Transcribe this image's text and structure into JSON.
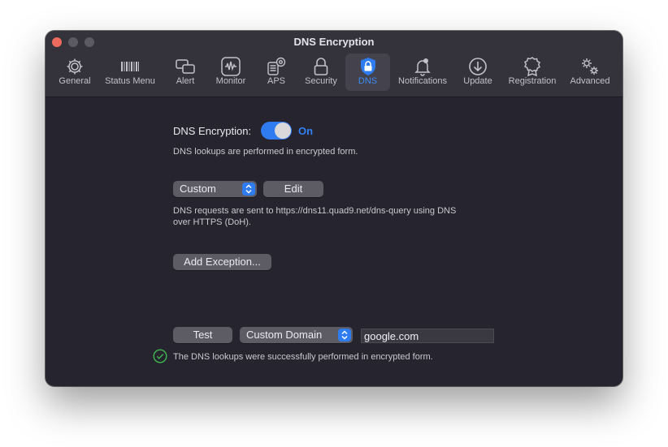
{
  "window": {
    "title": "DNS Encryption"
  },
  "toolbar": {
    "tabs": [
      {
        "id": "general",
        "label": "General",
        "icon": "gear-icon"
      },
      {
        "id": "status-menu",
        "label": "Status Menu",
        "icon": "menubar-icon"
      },
      {
        "id": "alert",
        "label": "Alert",
        "icon": "alert-windows-icon"
      },
      {
        "id": "monitor",
        "label": "Monitor",
        "icon": "monitor-icon"
      },
      {
        "id": "aps",
        "label": "APS",
        "icon": "aps-icon"
      },
      {
        "id": "security",
        "label": "Security",
        "icon": "lock-icon"
      },
      {
        "id": "dns",
        "label": "DNS",
        "icon": "shield-lock-icon"
      },
      {
        "id": "notifications",
        "label": "Notifications",
        "icon": "bell-icon"
      },
      {
        "id": "update",
        "label": "Update",
        "icon": "download-circle-icon"
      },
      {
        "id": "registration",
        "label": "Registration",
        "icon": "badge-icon"
      },
      {
        "id": "advanced",
        "label": "Advanced",
        "icon": "gears-icon"
      }
    ],
    "active_tab": "DNS"
  },
  "dns": {
    "encryption_label": "DNS Encryption:",
    "toggle_state": "On",
    "encryption_desc": "DNS lookups are performed in encrypted form.",
    "provider_selected": "Custom",
    "edit_label": "Edit",
    "requests_desc_line1": "DNS requests are sent to https://dns11.quad9.net/dns-query using DNS",
    "requests_desc_line2": "over HTTPS (DoH).",
    "add_exception_label": "Add Exception...",
    "test_label": "Test",
    "test_type_selected": "Custom Domain",
    "test_domain_value": "google.com",
    "test_result": "The DNS lookups were successfully performed in encrypted form."
  },
  "colors": {
    "accent": "#2f7bf0",
    "success": "#3fb950",
    "window_bg": "#26252f",
    "titlebar_bg": "#34323b"
  }
}
